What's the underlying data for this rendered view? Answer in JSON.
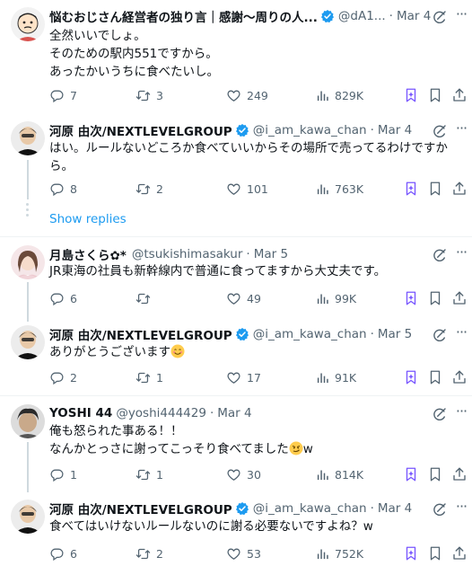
{
  "colors": {
    "accent": "#1d9bf0",
    "verified": "#1d9bf0",
    "grok_purple": "#7856ff",
    "text_secondary": "#536471",
    "separator": "#eff3f4"
  },
  "show_replies": "Show replies",
  "tweets": [
    {
      "name": "悩むおじさん経営者の独り言｜感謝〜周りの人...",
      "handle": "@dA1...",
      "time": "Mar 4",
      "lines": [
        "全然いいでしょ。",
        "そのための駅内551ですから。",
        "あったかいうちに食べたいし。"
      ],
      "replies": "7",
      "reposts": "3",
      "likes": "249",
      "views": "829K"
    },
    {
      "name": "河原 由次/NEXTLEVELGROUP",
      "handle": "@i_am_kawa_chan",
      "time": "Mar 4",
      "lines": [
        "はい。ルールないどころか食べていいからその場所で売ってるわけですか",
        "ら。"
      ],
      "replies": "8",
      "reposts": "2",
      "likes": "101",
      "views": "763K"
    },
    {
      "name": "月島さくら✿*",
      "handle": "@tsukishimasakur",
      "time": "Mar 5",
      "lines": [
        "JR東海の社員も新幹線内で普通に食ってますから大丈夫です。"
      ],
      "replies": "6",
      "reposts": "",
      "likes": "49",
      "views": "99K"
    },
    {
      "name": "河原 由次/NEXTLEVELGROUP",
      "handle": "@i_am_kawa_chan",
      "time": "Mar 5",
      "lines": [
        "ありがとうございます"
      ],
      "replies": "2",
      "reposts": "1",
      "likes": "17",
      "views": "91K"
    },
    {
      "name": "YOSHI 44",
      "handle": "@yoshi444429",
      "time": "Mar 4",
      "lines": [
        "俺も怒られた事ある！！",
        "なんかとっさに謝ってこっそり食べてました",
        "w"
      ],
      "replies": "1",
      "reposts": "1",
      "likes": "30",
      "views": "814K"
    },
    {
      "name": "河原 由次/NEXTLEVELGROUP",
      "handle": "@i_am_kawa_chan",
      "time": "Mar 4",
      "lines": [
        "食べてはいけないルールないのに謝る必要ないですよね？w"
      ],
      "replies": "6",
      "reposts": "2",
      "likes": "53",
      "views": "752K"
    }
  ]
}
